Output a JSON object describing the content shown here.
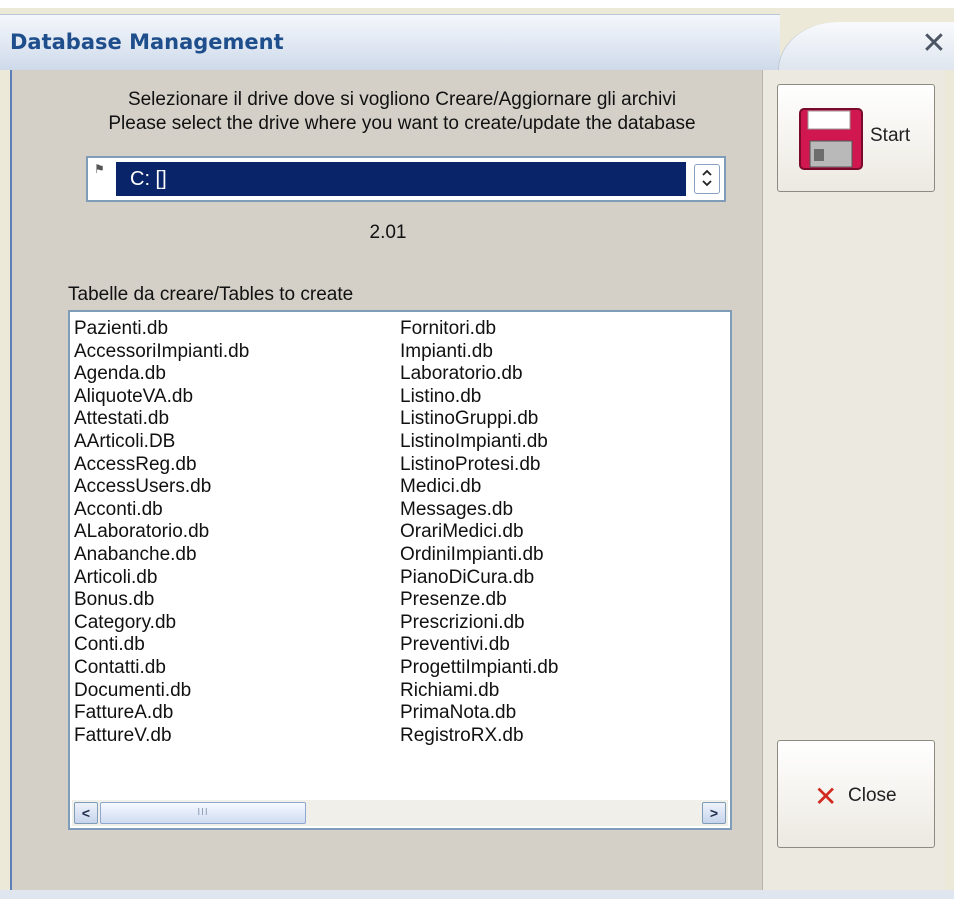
{
  "window": {
    "title": "Database Management",
    "close_glyph": "✕"
  },
  "instructions": {
    "line_it": "Selezionare il drive dove si vogliono Creare/Aggiornare gli archivi",
    "line_en": "Please select the drive where you want to create/update the database"
  },
  "drive_select": {
    "value": "C: []",
    "flag_glyph": "⚑"
  },
  "version": "2.01",
  "tables": {
    "label": "Tabelle da creare/Tables to create",
    "column1": [
      "Pazienti.db",
      "AccessoriImpianti.db",
      "Agenda.db",
      "AliquoteVA.db",
      "Attestati.db",
      "AArticoli.DB",
      "AccessReg.db",
      "AccessUsers.db",
      "Acconti.db",
      "ALaboratorio.db",
      "Anabanche.db",
      "Articoli.db",
      "Bonus.db",
      "Category.db",
      "Conti.db",
      "Contatti.db",
      "Documenti.db",
      "FattureA.db",
      "FattureV.db"
    ],
    "column2": [
      "Fornitori.db",
      "Impianti.db",
      "Laboratorio.db",
      "Listino.db",
      "ListinoGruppi.db",
      "ListinoImpianti.db",
      "ListinoProtesi.db",
      "Medici.db",
      "Messages.db",
      "OrariMedici.db",
      "OrdiniImpianti.db",
      "PianoDiCura.db",
      "Presenze.db",
      "Prescrizioni.db",
      "Preventivi.db",
      "ProgettiImpianti.db",
      "Richiami.db",
      "PrimaNota.db",
      "RegistroRX.db"
    ],
    "scroll_left": "<",
    "scroll_right": ">",
    "thumb_grip": "III"
  },
  "buttons": {
    "start_label": "Start",
    "close_label": "Close",
    "close_icon": "✕"
  },
  "colors": {
    "selection": "#0a246a",
    "title_text": "#1f4e8c",
    "floppy_body": "#d0174f",
    "close_icon": "#d12b1f"
  }
}
